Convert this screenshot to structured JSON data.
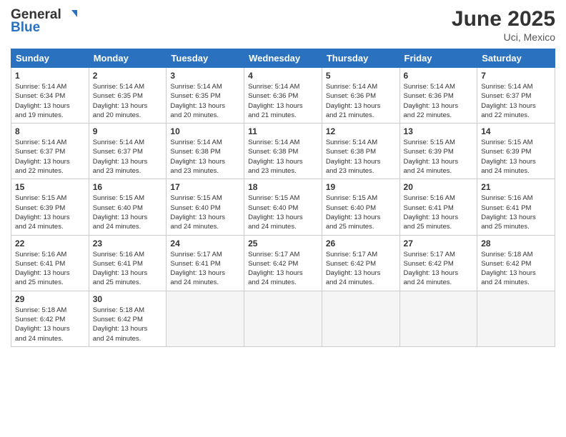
{
  "header": {
    "logo_line1": "General",
    "logo_line2": "Blue",
    "month": "June 2025",
    "location": "Uci, Mexico"
  },
  "weekdays": [
    "Sunday",
    "Monday",
    "Tuesday",
    "Wednesday",
    "Thursday",
    "Friday",
    "Saturday"
  ],
  "weeks": [
    [
      {
        "day": "1",
        "sunrise": "5:14 AM",
        "sunset": "6:34 PM",
        "daylight": "13 hours and 19 minutes."
      },
      {
        "day": "2",
        "sunrise": "5:14 AM",
        "sunset": "6:35 PM",
        "daylight": "13 hours and 20 minutes."
      },
      {
        "day": "3",
        "sunrise": "5:14 AM",
        "sunset": "6:35 PM",
        "daylight": "13 hours and 20 minutes."
      },
      {
        "day": "4",
        "sunrise": "5:14 AM",
        "sunset": "6:36 PM",
        "daylight": "13 hours and 21 minutes."
      },
      {
        "day": "5",
        "sunrise": "5:14 AM",
        "sunset": "6:36 PM",
        "daylight": "13 hours and 21 minutes."
      },
      {
        "day": "6",
        "sunrise": "5:14 AM",
        "sunset": "6:36 PM",
        "daylight": "13 hours and 22 minutes."
      },
      {
        "day": "7",
        "sunrise": "5:14 AM",
        "sunset": "6:37 PM",
        "daylight": "13 hours and 22 minutes."
      }
    ],
    [
      {
        "day": "8",
        "sunrise": "5:14 AM",
        "sunset": "6:37 PM",
        "daylight": "13 hours and 22 minutes."
      },
      {
        "day": "9",
        "sunrise": "5:14 AM",
        "sunset": "6:37 PM",
        "daylight": "13 hours and 23 minutes."
      },
      {
        "day": "10",
        "sunrise": "5:14 AM",
        "sunset": "6:38 PM",
        "daylight": "13 hours and 23 minutes."
      },
      {
        "day": "11",
        "sunrise": "5:14 AM",
        "sunset": "6:38 PM",
        "daylight": "13 hours and 23 minutes."
      },
      {
        "day": "12",
        "sunrise": "5:14 AM",
        "sunset": "6:38 PM",
        "daylight": "13 hours and 23 minutes."
      },
      {
        "day": "13",
        "sunrise": "5:15 AM",
        "sunset": "6:39 PM",
        "daylight": "13 hours and 24 minutes."
      },
      {
        "day": "14",
        "sunrise": "5:15 AM",
        "sunset": "6:39 PM",
        "daylight": "13 hours and 24 minutes."
      }
    ],
    [
      {
        "day": "15",
        "sunrise": "5:15 AM",
        "sunset": "6:39 PM",
        "daylight": "13 hours and 24 minutes."
      },
      {
        "day": "16",
        "sunrise": "5:15 AM",
        "sunset": "6:40 PM",
        "daylight": "13 hours and 24 minutes."
      },
      {
        "day": "17",
        "sunrise": "5:15 AM",
        "sunset": "6:40 PM",
        "daylight": "13 hours and 24 minutes."
      },
      {
        "day": "18",
        "sunrise": "5:15 AM",
        "sunset": "6:40 PM",
        "daylight": "13 hours and 24 minutes."
      },
      {
        "day": "19",
        "sunrise": "5:15 AM",
        "sunset": "6:40 PM",
        "daylight": "13 hours and 25 minutes."
      },
      {
        "day": "20",
        "sunrise": "5:16 AM",
        "sunset": "6:41 PM",
        "daylight": "13 hours and 25 minutes."
      },
      {
        "day": "21",
        "sunrise": "5:16 AM",
        "sunset": "6:41 PM",
        "daylight": "13 hours and 25 minutes."
      }
    ],
    [
      {
        "day": "22",
        "sunrise": "5:16 AM",
        "sunset": "6:41 PM",
        "daylight": "13 hours and 25 minutes."
      },
      {
        "day": "23",
        "sunrise": "5:16 AM",
        "sunset": "6:41 PM",
        "daylight": "13 hours and 25 minutes."
      },
      {
        "day": "24",
        "sunrise": "5:17 AM",
        "sunset": "6:41 PM",
        "daylight": "13 hours and 24 minutes."
      },
      {
        "day": "25",
        "sunrise": "5:17 AM",
        "sunset": "6:42 PM",
        "daylight": "13 hours and 24 minutes."
      },
      {
        "day": "26",
        "sunrise": "5:17 AM",
        "sunset": "6:42 PM",
        "daylight": "13 hours and 24 minutes."
      },
      {
        "day": "27",
        "sunrise": "5:17 AM",
        "sunset": "6:42 PM",
        "daylight": "13 hours and 24 minutes."
      },
      {
        "day": "28",
        "sunrise": "5:18 AM",
        "sunset": "6:42 PM",
        "daylight": "13 hours and 24 minutes."
      }
    ],
    [
      {
        "day": "29",
        "sunrise": "5:18 AM",
        "sunset": "6:42 PM",
        "daylight": "13 hours and 24 minutes."
      },
      {
        "day": "30",
        "sunrise": "5:18 AM",
        "sunset": "6:42 PM",
        "daylight": "13 hours and 24 minutes."
      },
      null,
      null,
      null,
      null,
      null
    ]
  ]
}
